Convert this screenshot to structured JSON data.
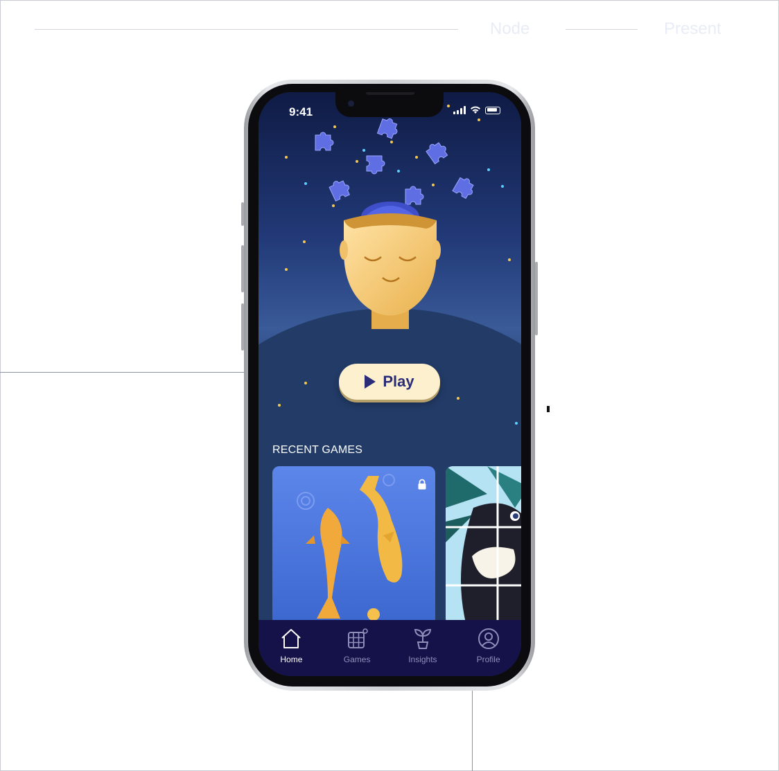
{
  "top_bar": {
    "label_node": "Node",
    "label_present": "Present"
  },
  "status_bar": {
    "time": "9:41"
  },
  "hero": {
    "play_label": "Play"
  },
  "recent": {
    "title": "RECENT GAMES",
    "cards": [
      {
        "name": "koi-fish-puzzle",
        "locked": true
      },
      {
        "name": "toucan-puzzle",
        "locked": false
      }
    ]
  },
  "tabbar": {
    "items": [
      {
        "label": "Home",
        "icon": "home-icon",
        "active": true
      },
      {
        "label": "Games",
        "icon": "games-grid-icon",
        "active": false
      },
      {
        "label": "Insights",
        "icon": "plant-icon",
        "active": false
      },
      {
        "label": "Profile",
        "icon": "profile-icon",
        "active": false
      }
    ]
  },
  "colors": {
    "sky_top": "#0f1b45",
    "background_blue": "#213863",
    "play_button": "#fdf0cf",
    "play_text": "#2a2c77",
    "tabbar_bg": "#15124a"
  }
}
